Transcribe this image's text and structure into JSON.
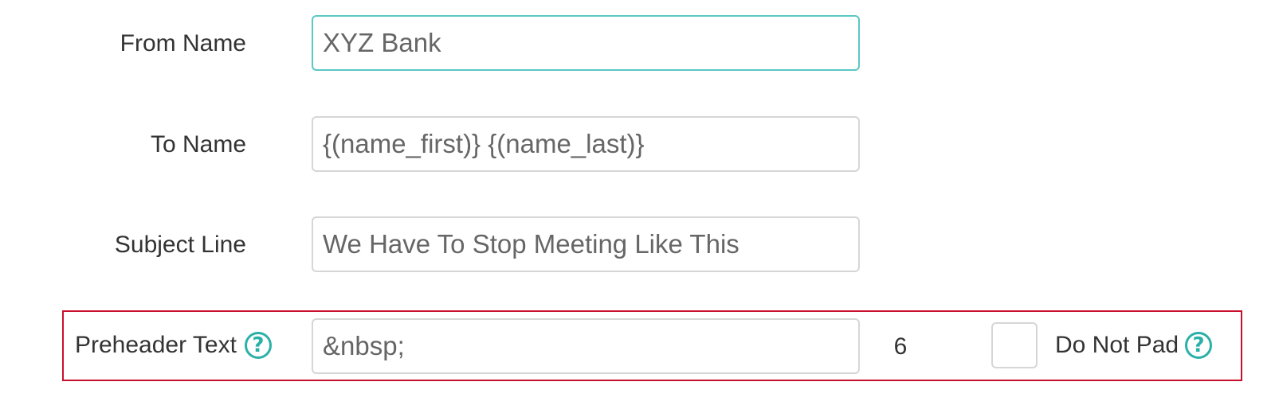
{
  "form": {
    "from_name": {
      "label": "From Name",
      "value": "XYZ Bank"
    },
    "to_name": {
      "label": "To Name",
      "value": "{(name_first)} {(name_last)}"
    },
    "subject_line": {
      "label": "Subject Line",
      "value": "We Have To Stop Meeting Like This"
    },
    "preheader": {
      "label": "Preheader Text",
      "value": "&nbsp;",
      "char_count": "6",
      "do_not_pad_label": "Do Not Pad",
      "do_not_pad_checked": false,
      "help_glyph": "?"
    }
  },
  "icons": {
    "preheader_help": "question-circle-icon",
    "do_not_pad_help": "question-circle-icon"
  },
  "colors": {
    "accent": "#2bb0a8",
    "focus_border": "#5bc8c4",
    "highlight_border": "#c8102e",
    "input_border": "#d6d6d6",
    "label_text": "#333333",
    "input_text": "#666666"
  }
}
